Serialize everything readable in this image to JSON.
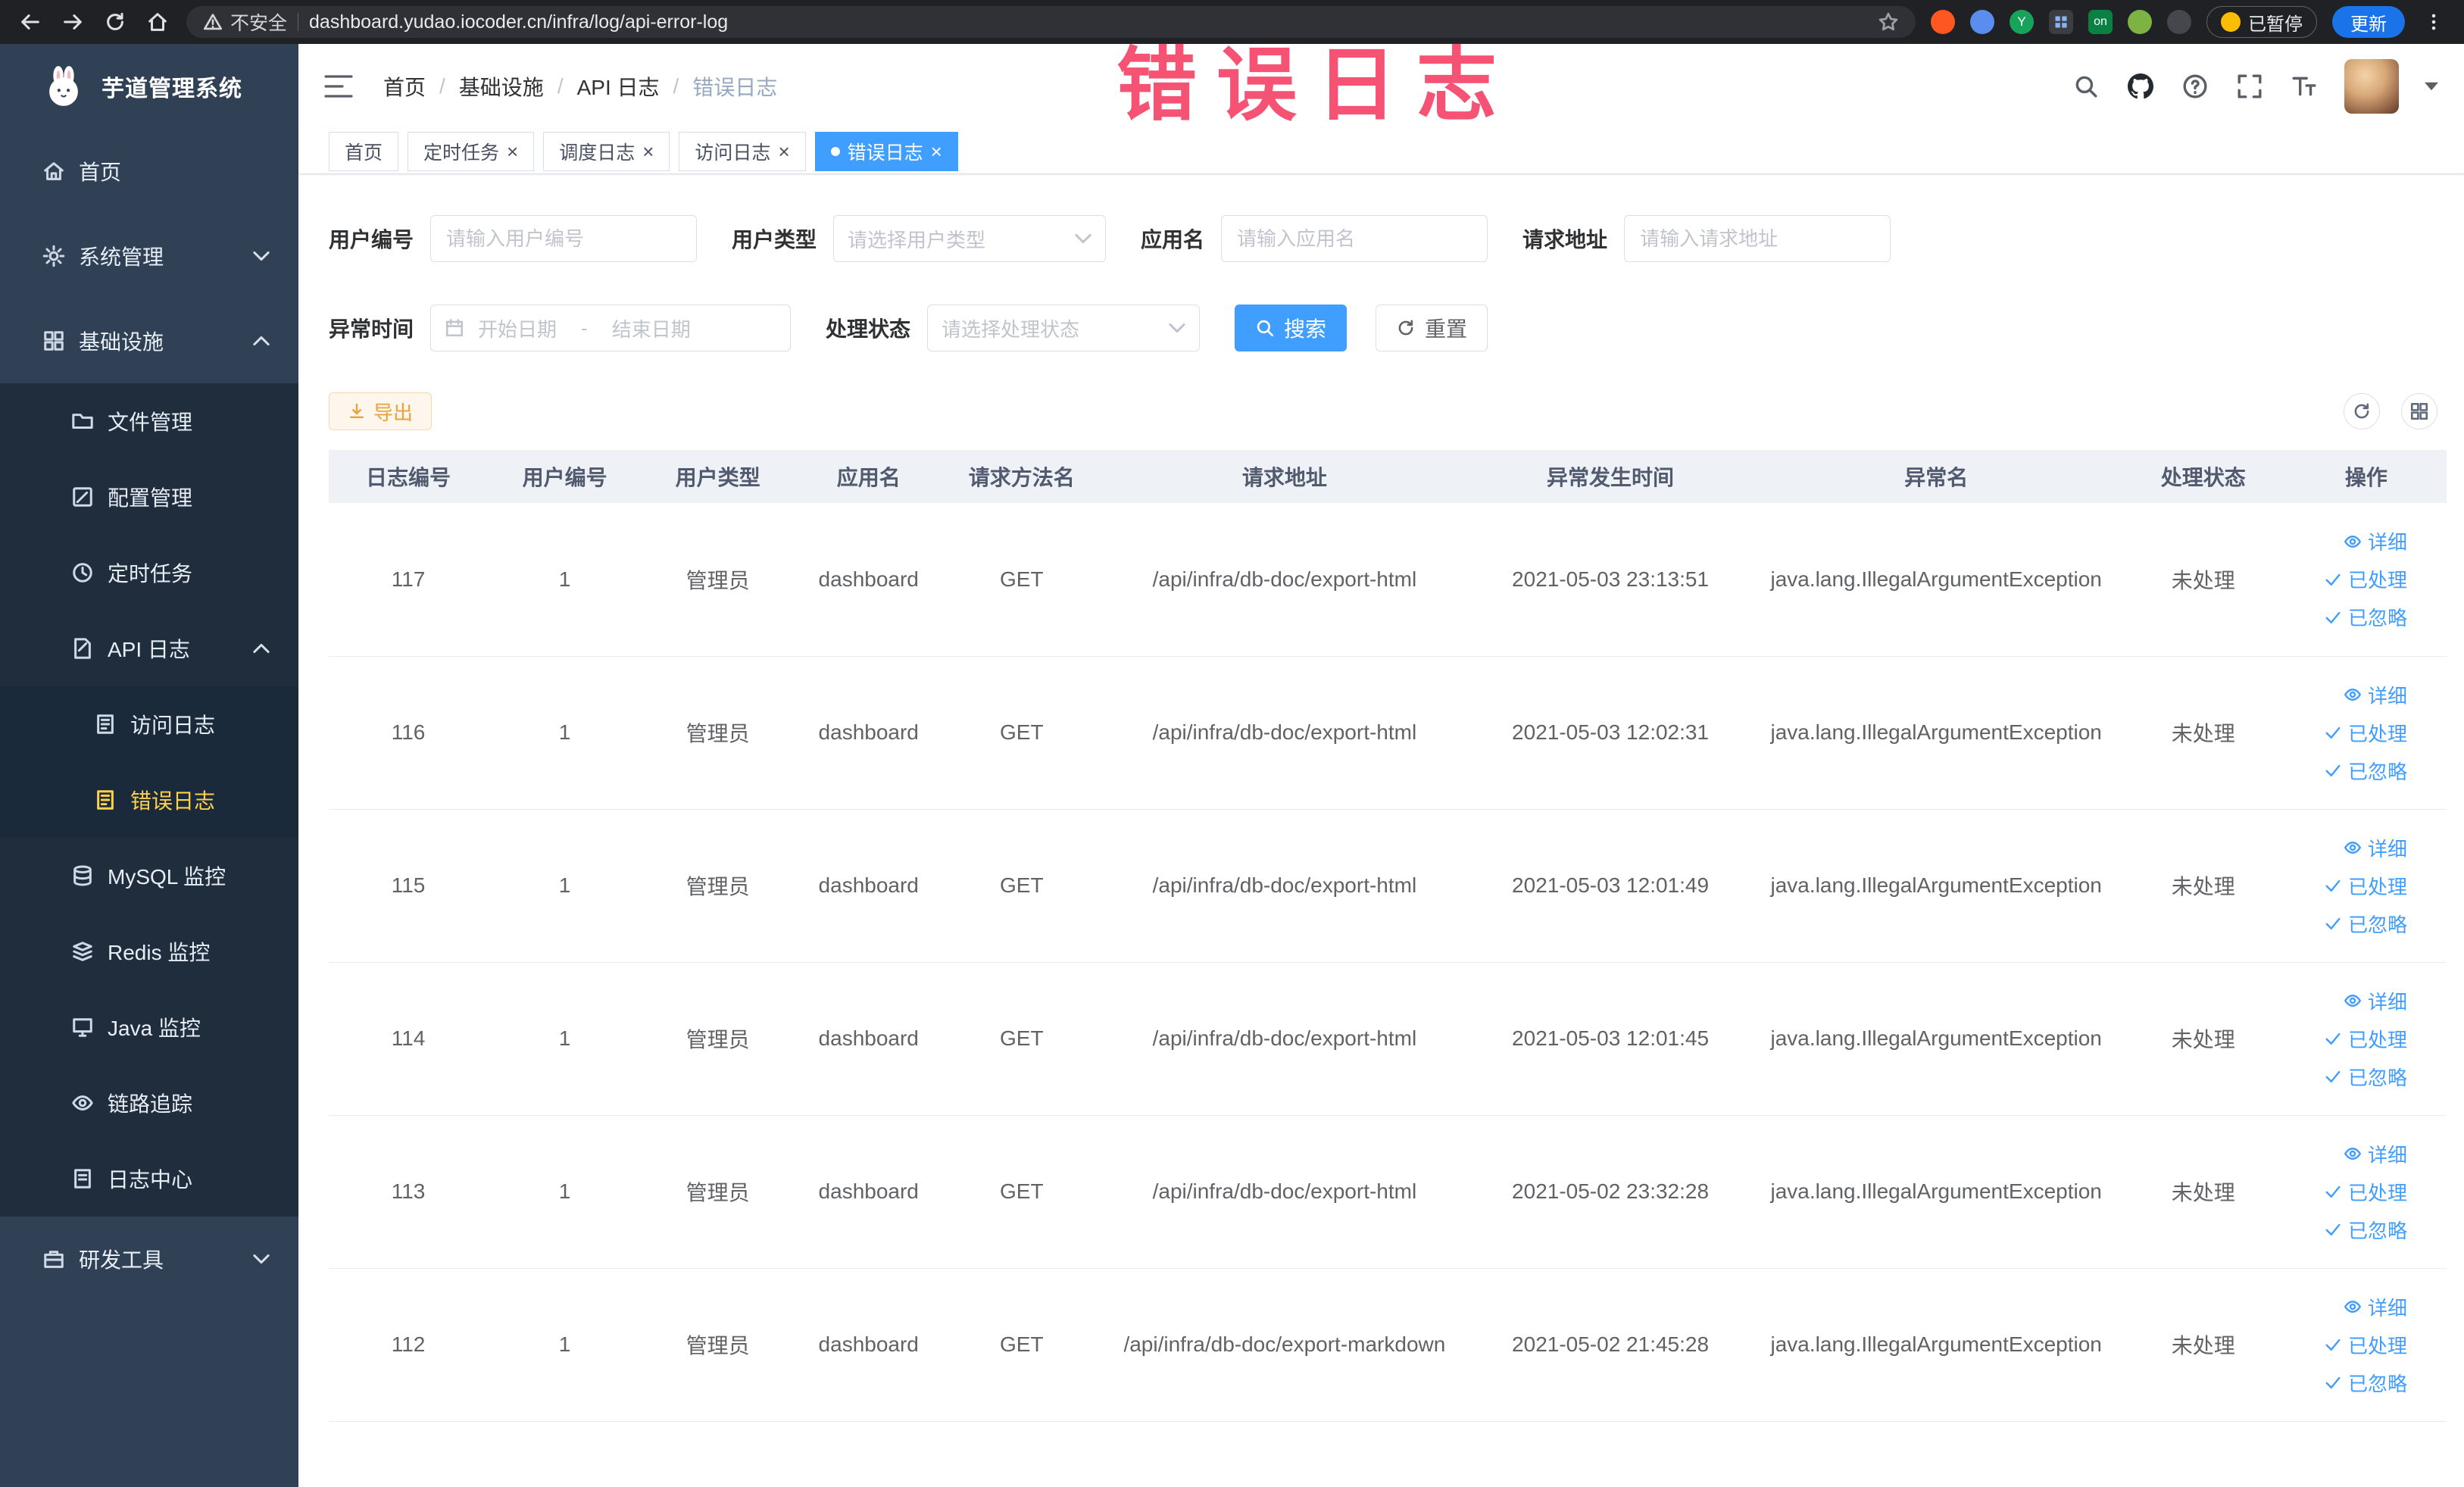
{
  "browser": {
    "security_label": "不安全",
    "url": "dashboard.yudao.iocoder.cn/infra/log/api-error-log",
    "extension_badge": "on",
    "paused_label": "已暂停",
    "update_label": "更新"
  },
  "sidebar": {
    "logo_title": "芋道管理系统",
    "items": [
      {
        "label": "首页",
        "icon": "home-icon"
      },
      {
        "label": "系统管理",
        "icon": "gear-icon",
        "state": "collapsed"
      },
      {
        "label": "基础设施",
        "icon": "infrastructure-icon",
        "state": "expanded"
      },
      {
        "label": "文件管理",
        "icon": "folder-icon"
      },
      {
        "label": "配置管理",
        "icon": "config-icon"
      },
      {
        "label": "定时任务",
        "icon": "schedule-icon"
      },
      {
        "label": "API 日志",
        "icon": "api-log-icon",
        "state": "expanded"
      },
      {
        "label": "访问日志",
        "icon": "access-log-icon"
      },
      {
        "label": "错误日志",
        "icon": "error-log-icon",
        "active": true
      },
      {
        "label": "MySQL 监控",
        "icon": "database-icon"
      },
      {
        "label": "Redis 监控",
        "icon": "redis-icon"
      },
      {
        "label": "Java 监控",
        "icon": "java-monitor-icon"
      },
      {
        "label": "链路追踪",
        "icon": "trace-icon"
      },
      {
        "label": "日志中心",
        "icon": "log-center-icon"
      },
      {
        "label": "研发工具",
        "icon": "devtools-icon",
        "state": "collapsed"
      }
    ]
  },
  "header": {
    "breadcrumb": [
      "首页",
      "基础设施",
      "API 日志",
      "错误日志"
    ],
    "separator": "/"
  },
  "annotation": {
    "text": "错误日志",
    "color": "#f44368"
  },
  "tabs": [
    {
      "label": "首页"
    },
    {
      "label": "定时任务"
    },
    {
      "label": "调度日志"
    },
    {
      "label": "访问日志"
    },
    {
      "label": "错误日志",
      "active": true
    }
  ],
  "filters": {
    "user_id": {
      "label": "用户编号",
      "placeholder": "请输入用户编号"
    },
    "user_type": {
      "label": "用户类型",
      "placeholder": "请选择用户类型"
    },
    "app_name": {
      "label": "应用名",
      "placeholder": "请输入应用名"
    },
    "request_url": {
      "label": "请求地址",
      "placeholder": "请输入请求地址"
    },
    "exception_time": {
      "label": "异常时间",
      "start_placeholder": "开始日期",
      "separator": "-",
      "end_placeholder": "结束日期"
    },
    "process_status": {
      "label": "处理状态",
      "placeholder": "请选择处理状态"
    },
    "search_label": "搜索",
    "reset_label": "重置"
  },
  "toolbar": {
    "export_label": "导出"
  },
  "table": {
    "headers": [
      "日志编号",
      "用户编号",
      "用户类型",
      "应用名",
      "请求方法名",
      "请求地址",
      "异常发生时间",
      "异常名",
      "处理状态",
      "操作"
    ],
    "actions": {
      "detail": "详细",
      "processed": "已处理",
      "ignored": "已忽略"
    },
    "rows": [
      {
        "log_id": "117",
        "user_id": "1",
        "user_type": "管理员",
        "app_name": "dashboard",
        "method": "GET",
        "request_url": "/api/infra/db-doc/export-html",
        "exception_time": "2021-05-03 23:13:51",
        "exception_name": "java.lang.IllegalArgumentException",
        "process_status": "未处理"
      },
      {
        "log_id": "116",
        "user_id": "1",
        "user_type": "管理员",
        "app_name": "dashboard",
        "method": "GET",
        "request_url": "/api/infra/db-doc/export-html",
        "exception_time": "2021-05-03 12:02:31",
        "exception_name": "java.lang.IllegalArgumentException",
        "process_status": "未处理"
      },
      {
        "log_id": "115",
        "user_id": "1",
        "user_type": "管理员",
        "app_name": "dashboard",
        "method": "GET",
        "request_url": "/api/infra/db-doc/export-html",
        "exception_time": "2021-05-03 12:01:49",
        "exception_name": "java.lang.IllegalArgumentException",
        "process_status": "未处理"
      },
      {
        "log_id": "114",
        "user_id": "1",
        "user_type": "管理员",
        "app_name": "dashboard",
        "method": "GET",
        "request_url": "/api/infra/db-doc/export-html",
        "exception_time": "2021-05-03 12:01:45",
        "exception_name": "java.lang.IllegalArgumentException",
        "process_status": "未处理"
      },
      {
        "log_id": "113",
        "user_id": "1",
        "user_type": "管理员",
        "app_name": "dashboard",
        "method": "GET",
        "request_url": "/api/infra/db-doc/export-html",
        "exception_time": "2021-05-02 23:32:28",
        "exception_name": "java.lang.IllegalArgumentException",
        "process_status": "未处理"
      },
      {
        "log_id": "112",
        "user_id": "1",
        "user_type": "管理员",
        "app_name": "dashboard",
        "method": "GET",
        "request_url": "/api/infra/db-doc/export-markdown",
        "exception_time": "2021-05-02 21:45:28",
        "exception_name": "java.lang.IllegalArgumentException",
        "process_status": "未处理"
      }
    ]
  }
}
